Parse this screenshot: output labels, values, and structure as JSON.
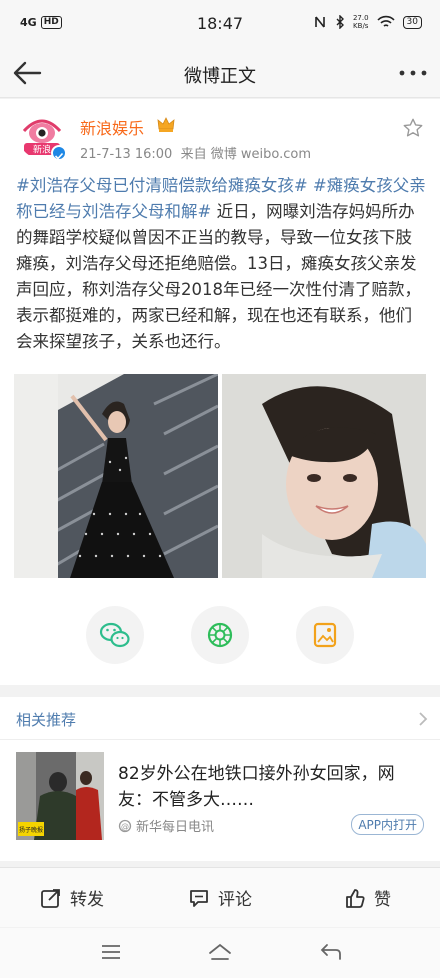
{
  "status_bar": {
    "network": "4G",
    "hd": "HD",
    "time": "18:47",
    "speed_value": "27.0",
    "speed_unit": "KB/s",
    "battery": "30"
  },
  "nav": {
    "title": "微博正文"
  },
  "post": {
    "author": "新浪娱乐",
    "avatar_text": "新浪",
    "timestamp": "21-7-13 16:00",
    "source": "来自 微博 weibo.com",
    "hashtag_1": "#刘浩存父母已付清赔偿款给瘫痪女孩#",
    "hashtag_2": "#瘫痪女孩父亲称已经与刘浩存父母和解#",
    "body": " 近日，网曝刘浩存妈妈所办的舞蹈学校疑似曾因不正当的教导，导致一位女孩下肢瘫痪，刘浩存父母还拒绝赔偿。13日，瘫痪女孩父亲发声回应，称刘浩存父母2018年已经一次性付清了赔款，表示都挺难的，两家已经和解，现在也还有联系，他们会来探望孩子，关系也还行。"
  },
  "related": {
    "section_title": "相关推荐",
    "headline": "82岁外公在地铁口接外孙女回家，网友：不管多大……",
    "source": "新华每日电讯",
    "open_label": "APP内打开",
    "thumb_caption": "扬子晚报"
  },
  "actions": {
    "repost": "转发",
    "comment": "评论",
    "like": "赞"
  },
  "colors": {
    "link_blue": "#4f7cae",
    "author_orange": "#f86a1b",
    "wechat_green": "#2ebd8d",
    "moments_green": "#2ebd5a",
    "album_orange": "#f2a21b"
  }
}
